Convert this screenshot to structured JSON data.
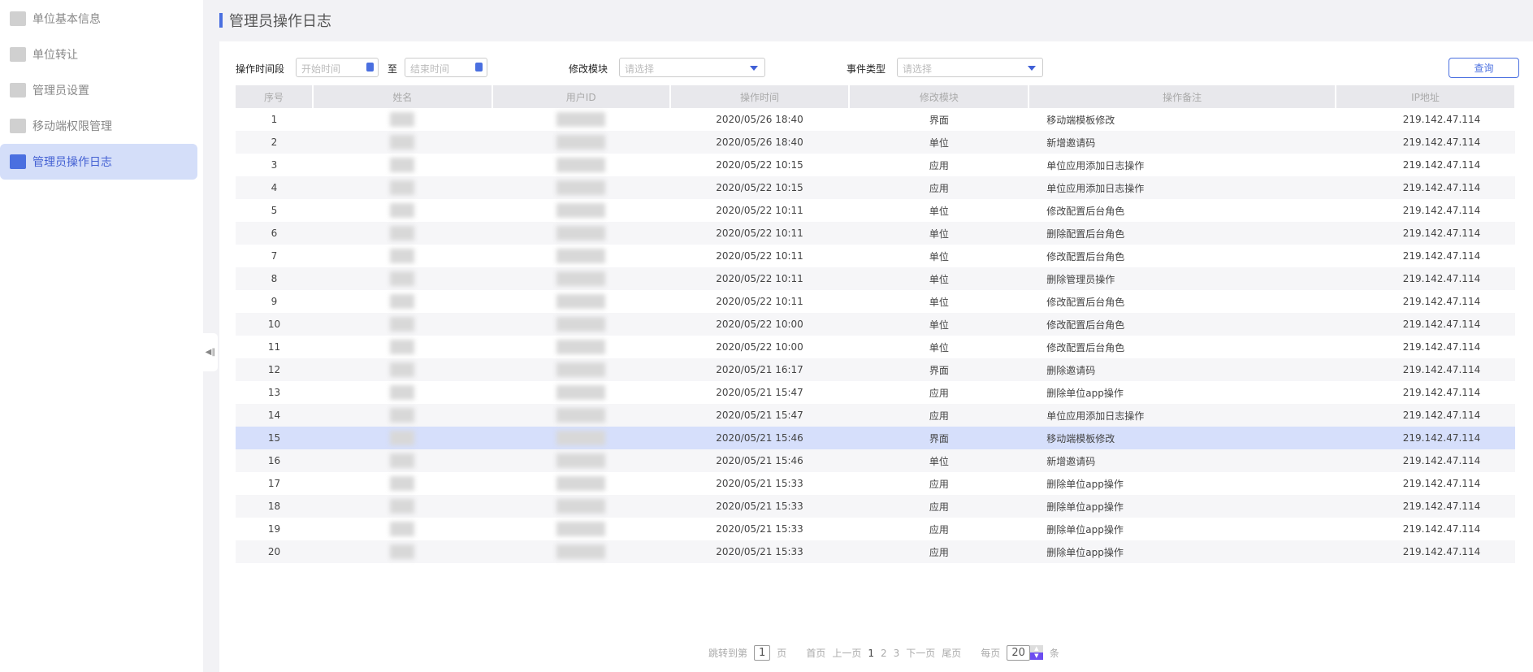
{
  "sidebar": {
    "items": [
      {
        "label": "单位基本信息"
      },
      {
        "label": "单位转让"
      },
      {
        "label": "管理员设置"
      },
      {
        "label": "移动端权限管理"
      },
      {
        "label": "管理员操作日志",
        "active": true
      }
    ]
  },
  "page_title": "管理员操作日志",
  "filters": {
    "period_label": "操作时间段",
    "start_placeholder": "开始时间",
    "to": "至",
    "end_placeholder": "结束时间",
    "module_label": "修改模块",
    "module_placeholder": "请选择",
    "event_label": "事件类型",
    "event_placeholder": "请选择",
    "query": "查询"
  },
  "table": {
    "headers": [
      "序号",
      "姓名",
      "用户ID",
      "操作时间",
      "修改模块",
      "操作备注",
      "IP地址"
    ],
    "rows": [
      [
        "1",
        "2020/05/26 18:40",
        "界面",
        "移动端模板修改"
      ],
      [
        "2",
        "2020/05/26 18:40",
        "单位",
        "新增邀请码"
      ],
      [
        "3",
        "2020/05/22 10:15",
        "应用",
        "单位应用添加日志操作"
      ],
      [
        "4",
        "2020/05/22 10:15",
        "应用",
        "单位应用添加日志操作"
      ],
      [
        "5",
        "2020/05/22 10:11",
        "单位",
        "修改配置后台角色"
      ],
      [
        "6",
        "2020/05/22 10:11",
        "单位",
        "删除配置后台角色"
      ],
      [
        "7",
        "2020/05/22 10:11",
        "单位",
        "修改配置后台角色"
      ],
      [
        "8",
        "2020/05/22 10:11",
        "单位",
        "删除管理员操作"
      ],
      [
        "9",
        "2020/05/22 10:11",
        "单位",
        "修改配置后台角色"
      ],
      [
        "10",
        "2020/05/22 10:00",
        "单位",
        "修改配置后台角色"
      ],
      [
        "11",
        "2020/05/22 10:00",
        "单位",
        "修改配置后台角色"
      ],
      [
        "12",
        "2020/05/21 16:17",
        "界面",
        "删除邀请码"
      ],
      [
        "13",
        "2020/05/21 15:47",
        "应用",
        "删除单位app操作"
      ],
      [
        "14",
        "2020/05/21 15:47",
        "应用",
        "单位应用添加日志操作"
      ],
      [
        "15",
        "2020/05/21 15:46",
        "界面",
        "移动端模板修改"
      ],
      [
        "16",
        "2020/05/21 15:46",
        "单位",
        "新增邀请码"
      ],
      [
        "17",
        "2020/05/21 15:33",
        "应用",
        "删除单位app操作"
      ],
      [
        "18",
        "2020/05/21 15:33",
        "应用",
        "删除单位app操作"
      ],
      [
        "19",
        "2020/05/21 15:33",
        "应用",
        "删除单位app操作"
      ],
      [
        "20",
        "2020/05/21 15:33",
        "应用",
        "删除单位app操作"
      ]
    ],
    "ip": "219.142.47.114",
    "selected_row": 15
  },
  "pager": {
    "jump_prefix": "跳转到第",
    "jump_value": "1",
    "jump_suffix": "页",
    "first": "首页",
    "prev": "上一页",
    "pages": [
      "1",
      "2",
      "3"
    ],
    "next": "下一页",
    "last": "尾页",
    "per_page_prefix": "每页",
    "per_page": "20",
    "per_page_suffix": "条"
  }
}
